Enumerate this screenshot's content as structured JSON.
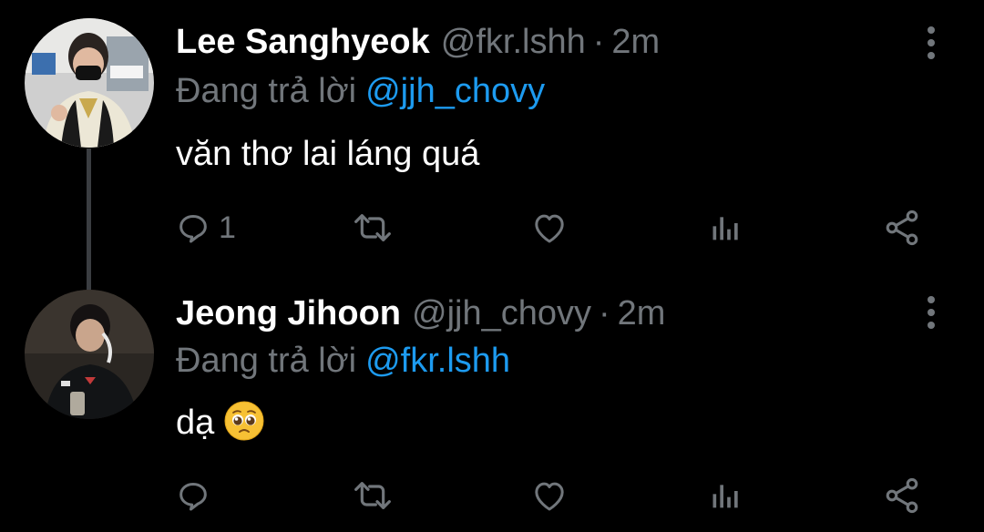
{
  "tweets": [
    {
      "name": "Lee Sanghyeok",
      "handle": "@fkr.lshh",
      "separator": "·",
      "time": "2m",
      "reply_prefix": "Đang trả lời",
      "reply_to": "@jjh_chovy",
      "text": "văn thơ lai láng quá",
      "reply_count": "1",
      "icons": [
        "reply-icon",
        "retweet-icon",
        "like-icon",
        "views-icon",
        "share-icon",
        "more-icon"
      ]
    },
    {
      "name": "Jeong Jihoon",
      "handle": "@jjh_chovy",
      "separator": "·",
      "time": "2m",
      "reply_prefix": "Đang trả lời",
      "reply_to": "@fkr.lshh",
      "text": "dạ",
      "emoji": "pleading-face",
      "reply_count": "",
      "icons": [
        "reply-icon",
        "retweet-icon",
        "like-icon",
        "views-icon",
        "share-icon",
        "more-icon"
      ]
    }
  ],
  "colors": {
    "background": "#000000",
    "primary_text": "#ffffff",
    "secondary_text": "#71767b",
    "accent": "#1d9bf0",
    "thread_line": "#3a3d41"
  }
}
